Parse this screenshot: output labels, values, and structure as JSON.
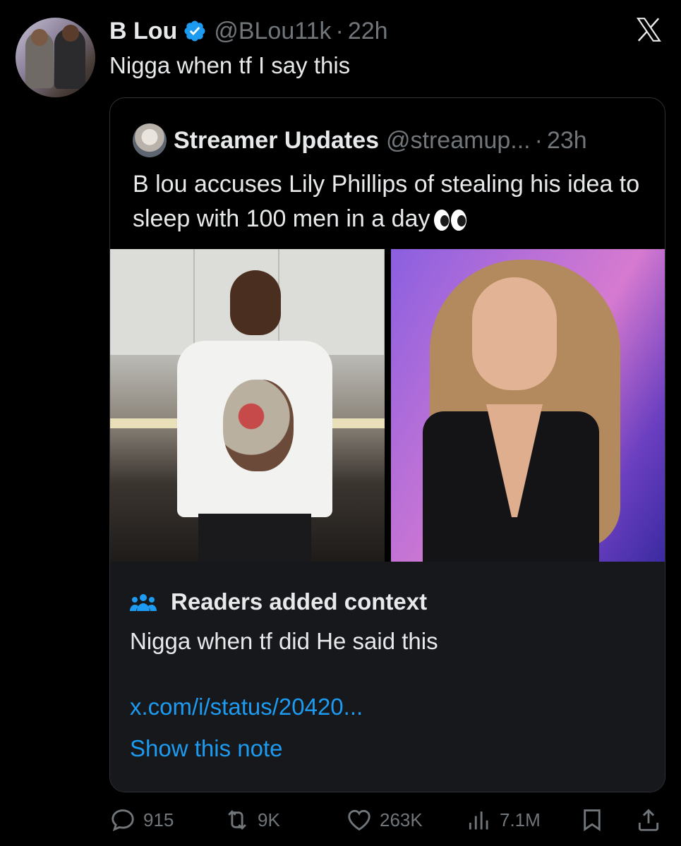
{
  "tweet": {
    "author_name": "B Lou",
    "handle": "@BLou11k",
    "separator": "·",
    "time": "22h",
    "text": "Nigga when tf I say this"
  },
  "quoted": {
    "author_name": "Streamer Updates",
    "handle": "@streamup...",
    "separator": "·",
    "time": "23h",
    "text": "B lou accuses Lily Phillips of stealing his idea to sleep with 100 men in a day"
  },
  "context": {
    "title": "Readers added context",
    "text": "Nigga when tf did He said this",
    "link": "x.com/i/status/20420...",
    "show_note": "Show this note"
  },
  "actions": {
    "replies": "915",
    "reposts": "9K",
    "likes": "263K",
    "views": "7.1M"
  },
  "colors": {
    "background": "#000000",
    "text": "#e7e9ea",
    "muted": "#71767b",
    "link": "#1d9bf0",
    "verified": "#1d9bf0",
    "context_bg": "#16181c"
  },
  "icons": [
    "verified-icon",
    "x-logo-icon",
    "eyes-emoji",
    "readers-icon",
    "reply-icon",
    "repost-icon",
    "like-icon",
    "views-icon",
    "bookmark-icon",
    "share-icon"
  ]
}
